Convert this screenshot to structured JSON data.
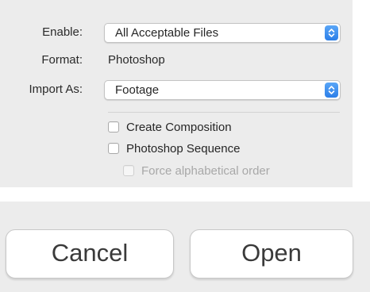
{
  "options": {
    "enable_label": "Enable:",
    "enable_value": "All Acceptable Files",
    "format_label": "Format:",
    "format_value": "Photoshop",
    "import_as_label": "Import As:",
    "import_as_value": "Footage",
    "checkboxes": [
      {
        "label": "Create Composition",
        "checked": false,
        "enabled": true
      },
      {
        "label": "Photoshop Sequence",
        "checked": false,
        "enabled": true
      },
      {
        "label": "Force alphabetical order",
        "checked": false,
        "enabled": false
      }
    ]
  },
  "buttons": {
    "cancel_label": "Cancel",
    "open_label": "Open"
  },
  "colors": {
    "panel_bg": "#ececec",
    "stepper_accent": "#2b7ee8"
  },
  "icons": {
    "popup_stepper": "chevron-up-down-icon"
  }
}
